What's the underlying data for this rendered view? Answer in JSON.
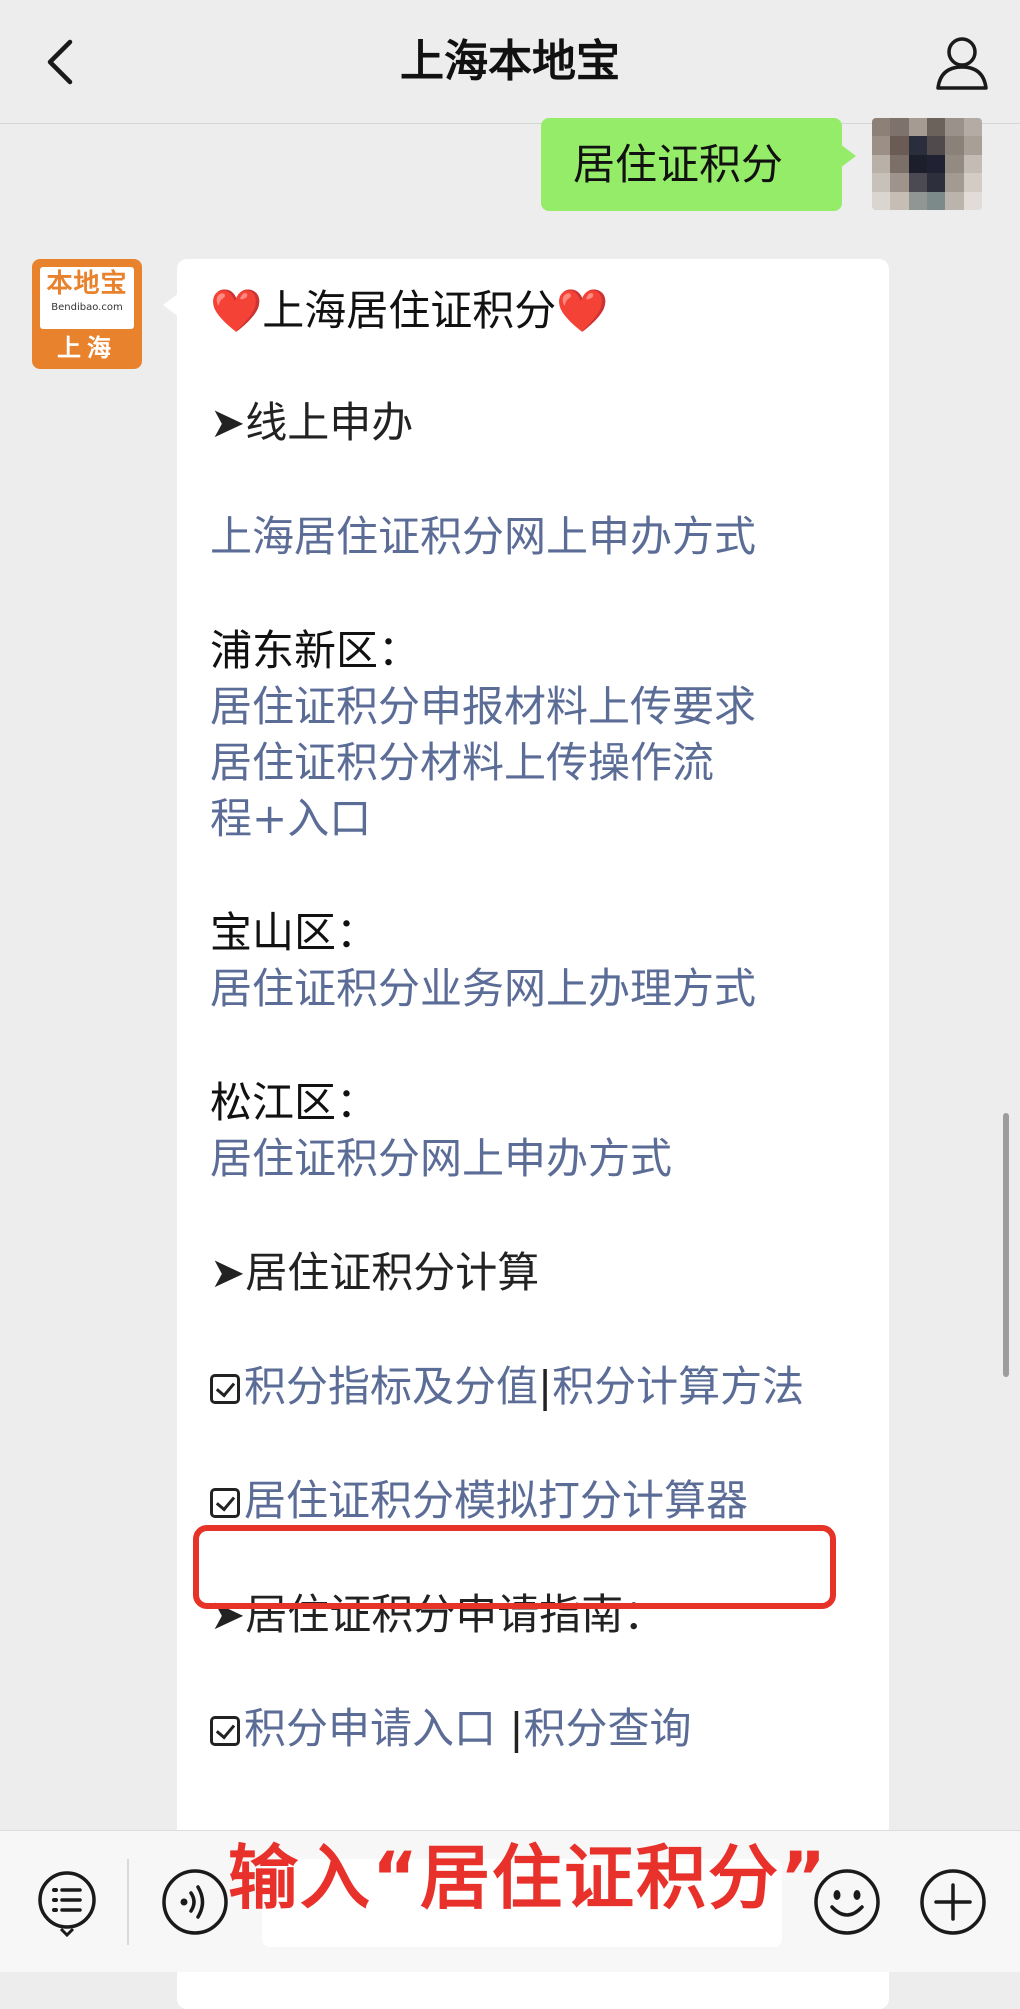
{
  "navbar": {
    "title": "上海本地宝",
    "back_icon": "chevron-left-icon",
    "profile_icon": "person-icon"
  },
  "outgoing_message": {
    "text": "居住证积分",
    "bubble_color": "#95ec69"
  },
  "account_avatar": {
    "brand": "本地宝",
    "domain": "Bendibao.com",
    "city": "上海",
    "color": "#e8822d"
  },
  "message": {
    "title": "上海居住证积分",
    "heart_icon": "❤️",
    "sections": {
      "online": {
        "heading": "➤线上申办",
        "main_link": "上海居住证积分网上申办方式",
        "pudong_label": "浦东新区：",
        "pudong_link_1": "居住证积分申报材料上传要求",
        "pudong_link_2": "居住证积分材料上传操作流程+入口",
        "baoshan_label": "宝山区：",
        "baoshan_link": "居住证积分业务网上办理方式",
        "songjiang_label": "松江区：",
        "songjiang_link": "居住证积分网上申办方式"
      },
      "calc": {
        "heading": "➤居住证积分计算",
        "link_1a": "积分指标及分值",
        "separator": "|",
        "link_1b": "积分计算方法",
        "link_2": "居住证积分模拟打分计算器"
      },
      "guide": {
        "heading": "➤居住证积分申请指南：",
        "link_1a": "积分申请入口 ",
        "separator": "|",
        "link_1b": "积分查询"
      }
    },
    "link_color": "#5b6c97",
    "highlight_color": "#e63227"
  },
  "overlay": {
    "text": "输入“居住证积分”",
    "color": "#e8312a"
  },
  "bottombar": {
    "menu_icon": "list-menu-icon",
    "voice_icon": "voice-icon",
    "emoji_icon": "emoji-icon",
    "plus_icon": "plus-icon"
  }
}
